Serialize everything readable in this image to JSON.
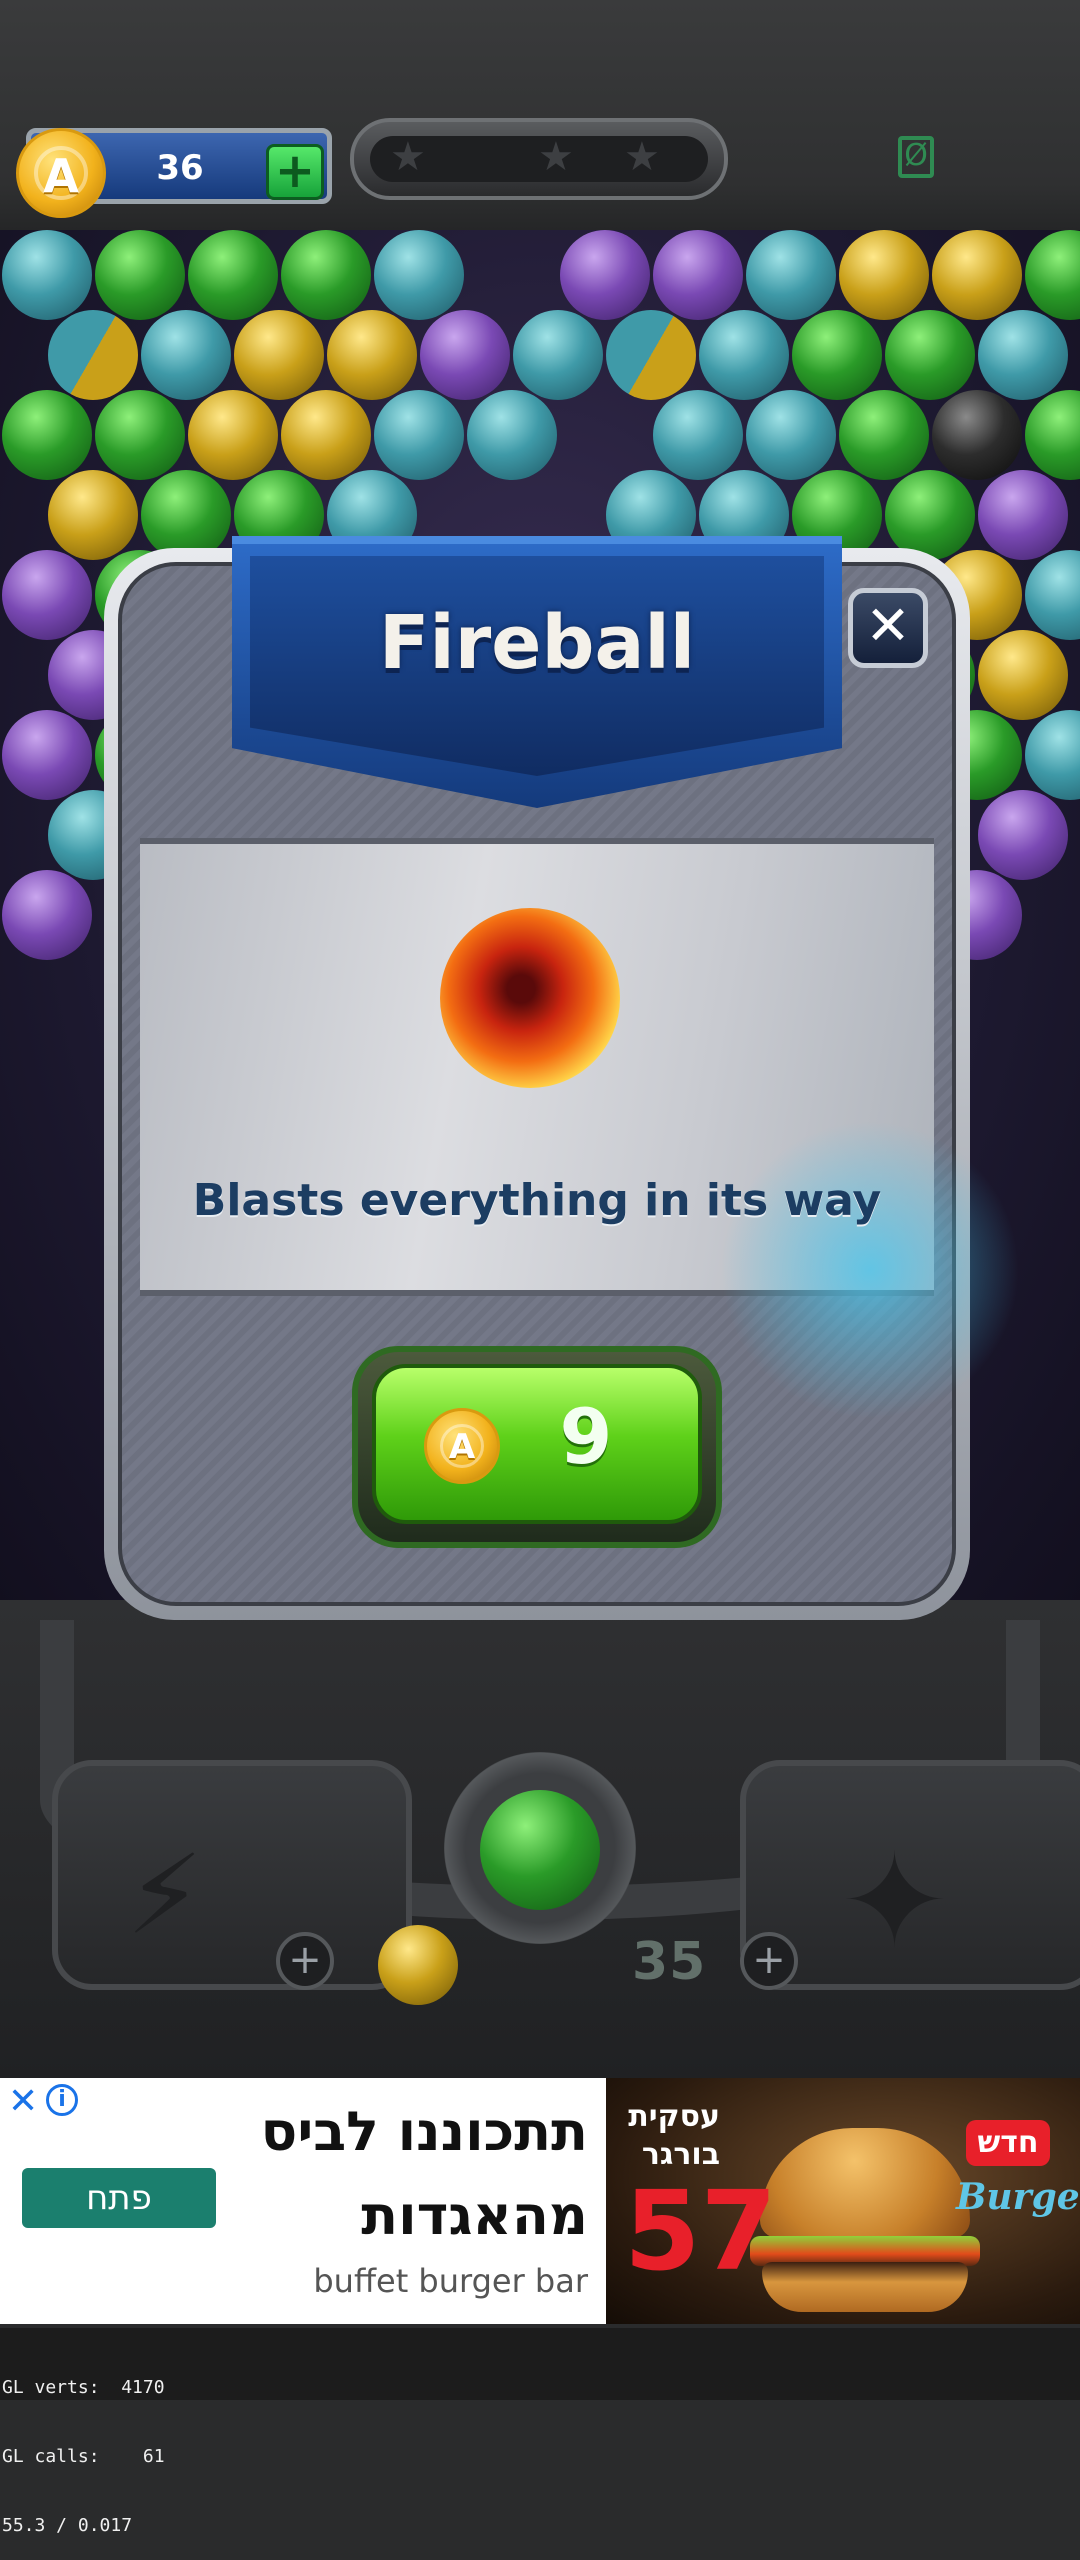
{
  "hud": {
    "coins": "36",
    "coin_symbol": "A",
    "add_coins_symbol": "+",
    "stars_earned": 0,
    "stars_total": 3,
    "star_glyph": "★",
    "pause_symbol": "Ø"
  },
  "modal": {
    "title": "Fireball",
    "description": "Blasts everything in its way",
    "close_symbol": "✕",
    "price": "9",
    "coin_symbol": "A"
  },
  "controls": {
    "shots_left": "35",
    "plus_symbol": "+",
    "lightning_icon": "⚡",
    "sparkle_icon": "✦"
  },
  "ad": {
    "close_symbol": "✕",
    "info_symbol": "i",
    "headline_line1": "תתכוננו לביס",
    "headline_line2": "מהאגדות",
    "cta": "פתח",
    "advertiser": "buffet burger bar",
    "image_text_line1": "עסקית",
    "image_text_line2": "בורגר",
    "image_price": "57",
    "image_badge": "חדש",
    "image_brand": "Burger"
  },
  "debug": {
    "line1": "GL verts:  4170",
    "line2": "GL calls:    61",
    "line3": "55.3 / 0.017"
  },
  "colors": {
    "coin_gold": "#f2b21c",
    "buy_green": "#5fd11a",
    "banner_blue": "#1e4f9e",
    "ad_cta": "#1b7f6e",
    "ad_price_red": "#e8202a"
  }
}
